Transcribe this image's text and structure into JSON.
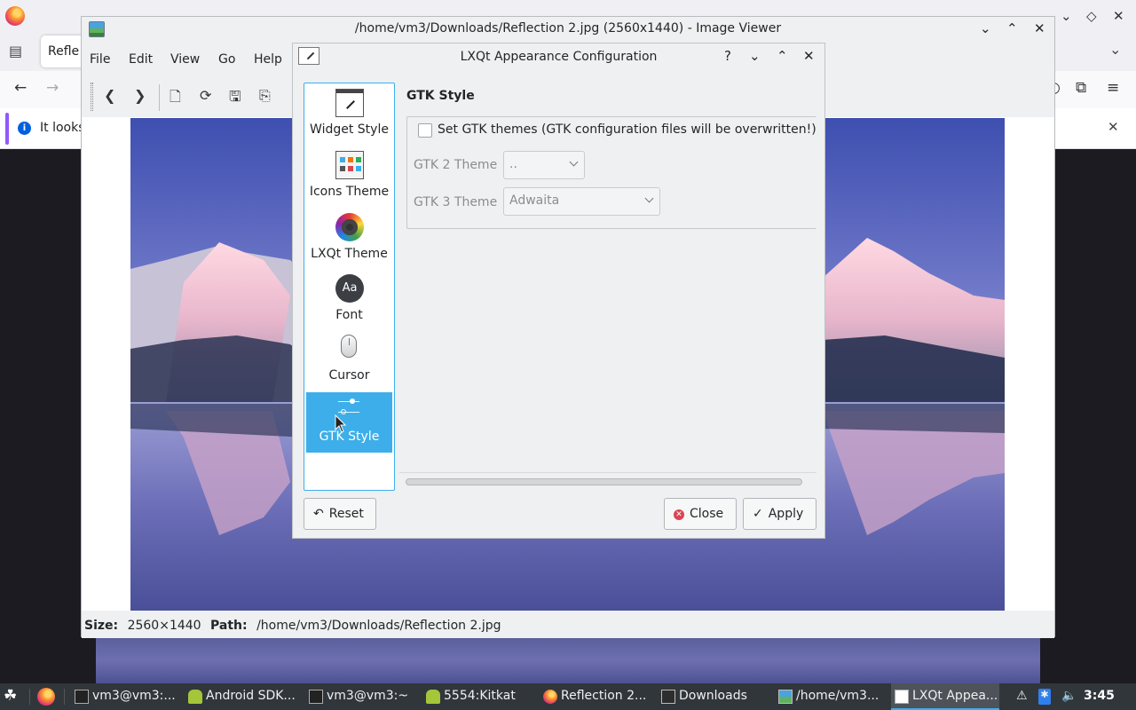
{
  "firefox": {
    "tab_label": "Refle",
    "notification_text": "It looks"
  },
  "image_viewer": {
    "window_title": "/home/vm3/Downloads/Reflection 2.jpg (2560x1440) - Image Viewer",
    "menu": [
      "File",
      "Edit",
      "View",
      "Go",
      "Help"
    ],
    "status": {
      "size_label": "Size:",
      "size_value": "2560×1440",
      "path_label": "Path:",
      "path_value": "/home/vm3/Downloads/Reflection 2.jpg"
    }
  },
  "dialog": {
    "title": "LXQt Appearance Configuration",
    "sidebar": [
      {
        "label": "Widget Style",
        "icon": "widget-style-icon",
        "selected": false
      },
      {
        "label": "Icons Theme",
        "icon": "icons-theme-icon",
        "selected": false
      },
      {
        "label": "LXQt Theme",
        "icon": "lxqt-theme-icon",
        "selected": false
      },
      {
        "label": "Font",
        "icon": "font-icon",
        "selected": false
      },
      {
        "label": "Cursor",
        "icon": "cursor-icon",
        "selected": false
      },
      {
        "label": "GTK Style",
        "icon": "gtk-style-icon",
        "selected": true
      }
    ],
    "panel": {
      "title": "GTK Style",
      "set_gtk_checkbox": {
        "label": "Set GTK themes (GTK configuration files will be overwritten!)",
        "checked": false
      },
      "gtk2": {
        "label": "GTK 2 Theme",
        "value": ".."
      },
      "gtk3": {
        "label": "GTK 3 Theme",
        "value": "Adwaita"
      }
    },
    "buttons": {
      "reset": "Reset",
      "close": "Close",
      "apply": "Apply"
    },
    "font_icon_glyph": "Aa"
  },
  "taskbar": {
    "tasks": [
      {
        "label": "vm3@vm3:...",
        "icon": "terminal-icon",
        "active": false
      },
      {
        "label": "Android SDK...",
        "icon": "android-sdk-icon",
        "active": false
      },
      {
        "label": "vm3@vm3:~",
        "icon": "terminal-icon",
        "active": false
      },
      {
        "label": "5554:Kitkat",
        "icon": "android-icon",
        "active": false
      },
      {
        "label": "Reflection 2...",
        "icon": "firefox-icon",
        "active": false
      },
      {
        "label": "Downloads",
        "icon": "folder-icon",
        "active": false
      },
      {
        "label": "/home/vm3...",
        "icon": "image-viewer-icon",
        "active": false
      },
      {
        "label": "LXQt Appea...",
        "icon": "lxqt-config-icon",
        "active": true
      }
    ],
    "clock": "3:45"
  },
  "colors": {
    "accent": "#3daee9",
    "window_bg": "#eff0f1",
    "taskbar_bg": "#31363b",
    "close_red": "#da4453"
  }
}
